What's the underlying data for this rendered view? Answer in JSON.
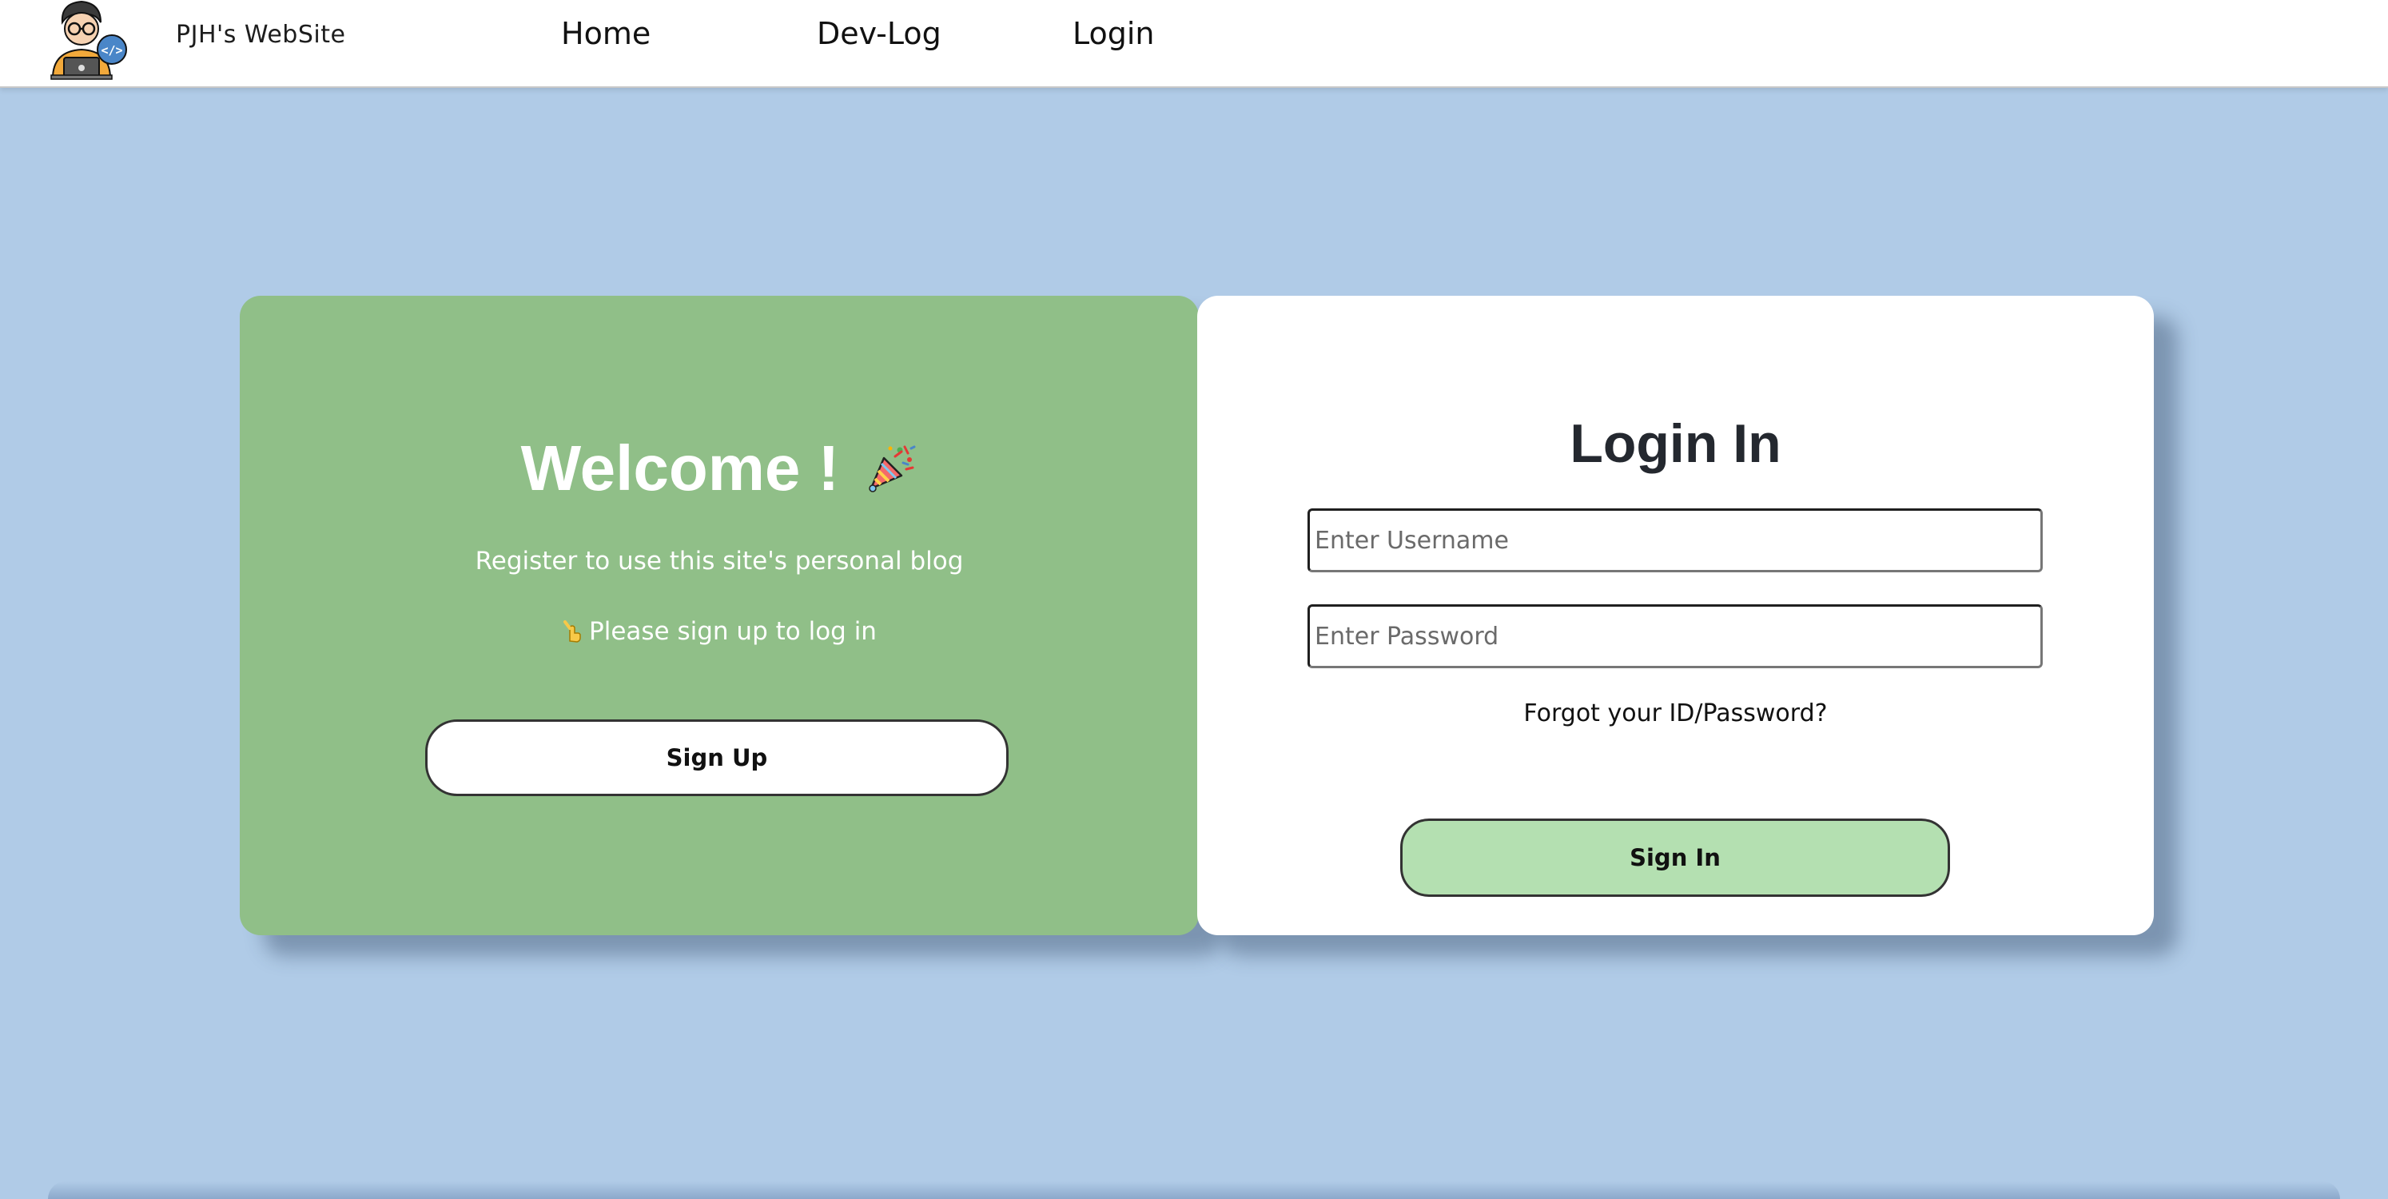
{
  "header": {
    "site_name": "PJH's WebSite",
    "nav": {
      "home": "Home",
      "devlog": "Dev-Log",
      "login": "Login"
    }
  },
  "welcome_panel": {
    "title": "Welcome !",
    "subtitle": "Register to use this site's personal blog",
    "hint": "Please sign up to log in",
    "signup_label": "Sign Up",
    "background_color": "#90bf88"
  },
  "login_panel": {
    "title": "Login In",
    "username_placeholder": "Enter Username",
    "password_placeholder": "Enter Password",
    "forgot_label": "Forgot your ID/Password?",
    "signin_label": "Sign In",
    "signin_color": "#b4e0b1"
  },
  "colors": {
    "page_background": "#b0cbe7",
    "header_background": "#ffffff"
  },
  "icons": {
    "logo": "developer-avatar-icon",
    "party": "party-popper-icon",
    "point": "pointing-down-hand-icon"
  }
}
